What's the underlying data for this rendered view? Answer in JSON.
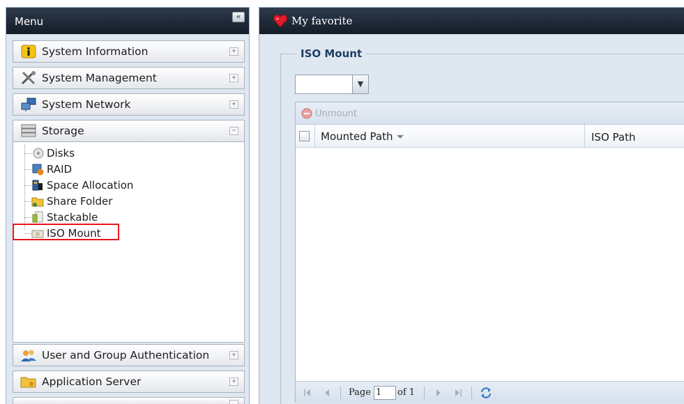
{
  "menu": {
    "title": "Menu",
    "collapse_label": "«",
    "items": [
      {
        "label": "System Information",
        "icon": "info-icon",
        "toggle": "+"
      },
      {
        "label": "System Management",
        "icon": "tools-icon",
        "toggle": "+"
      },
      {
        "label": "System Network",
        "icon": "network-icon",
        "toggle": "+"
      },
      {
        "label": "Storage",
        "icon": "storage-icon",
        "toggle": "−"
      },
      {
        "label": "User and Group Authentication",
        "icon": "users-icon",
        "toggle": "+"
      },
      {
        "label": "Application Server",
        "icon": "app-server-icon",
        "toggle": "+"
      }
    ],
    "storage_children": [
      {
        "label": "Disks",
        "icon": "disk-icon"
      },
      {
        "label": "RAID",
        "icon": "raid-icon"
      },
      {
        "label": "Space Allocation",
        "icon": "space-allocation-icon"
      },
      {
        "label": "Share Folder",
        "icon": "share-folder-icon"
      },
      {
        "label": "Stackable",
        "icon": "stackable-icon"
      },
      {
        "label": "ISO Mount",
        "icon": "iso-mount-icon"
      }
    ],
    "highlight_color": "#e8141c"
  },
  "favorite": {
    "title": "My favorite",
    "icon": "heart-icon"
  },
  "iso_mount": {
    "legend": "ISO Mount",
    "selected_value": "",
    "toolbar": {
      "unmount_label": "Unmount"
    },
    "columns": [
      "Mounted Path",
      "ISO Path"
    ],
    "rows": [],
    "paging": {
      "page_label": "Page",
      "page_value": "1",
      "of_label": "of 1"
    }
  }
}
